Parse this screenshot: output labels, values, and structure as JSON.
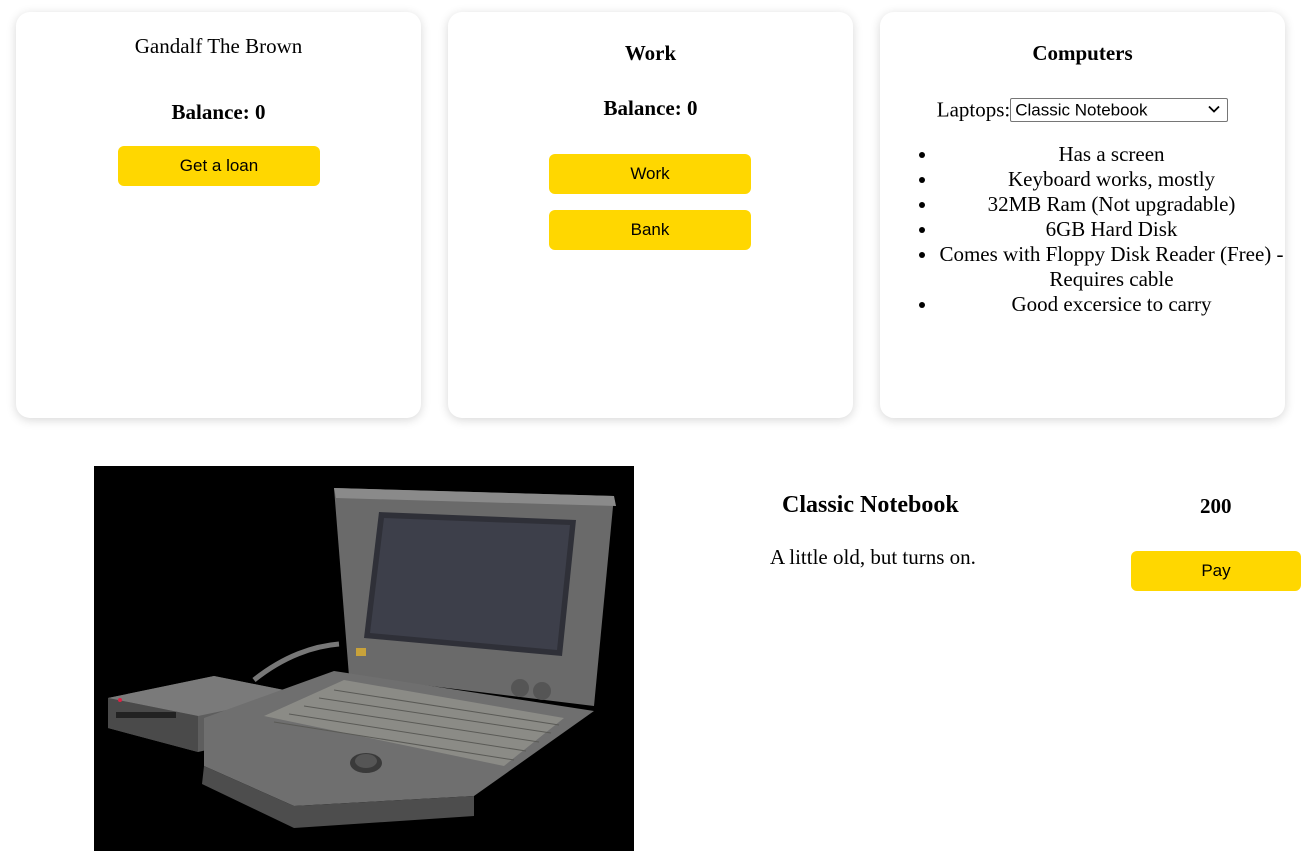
{
  "bank": {
    "customer_name": "Gandalf The Brown",
    "balance_label": "Balance: 0",
    "loan_button": "Get a loan"
  },
  "work": {
    "title": "Work",
    "balance_label": "Balance: 0",
    "work_button": "Work",
    "bank_button": "Bank"
  },
  "computers": {
    "title": "Computers",
    "laptops_label": "Laptops:",
    "selected_laptop": "Classic Notebook",
    "features": [
      "Has a screen",
      "Keyboard works, mostly",
      "32MB Ram (Not upgradable)",
      "6GB Hard Disk",
      "Comes with Floppy Disk Reader (Free) - Requires cable",
      "Good excersice to carry"
    ]
  },
  "laptop_info": {
    "name": "Classic Notebook",
    "price": "200",
    "description": "A little old, but turns on.",
    "pay_button": "Pay"
  },
  "colors": {
    "button": "#ffd700",
    "photo_background": "#000000"
  },
  "icons": {
    "select_arrow": "chevron-down-icon"
  }
}
